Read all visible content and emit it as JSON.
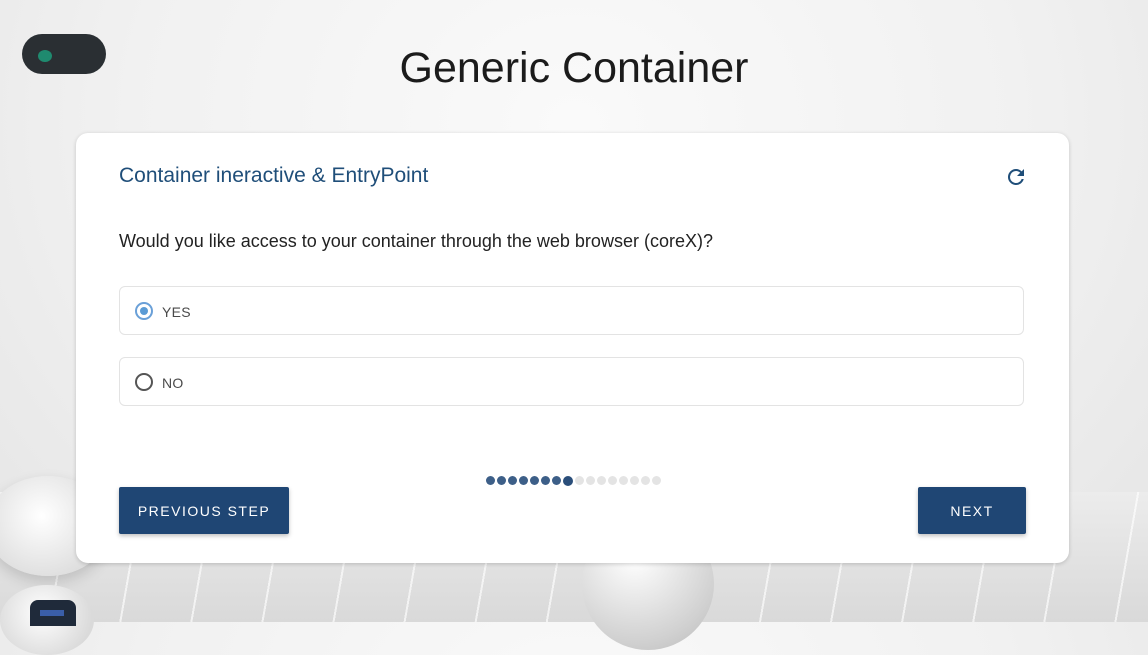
{
  "page": {
    "title": "Generic Container"
  },
  "card": {
    "title": "Container ineractive & EntryPoint",
    "refresh_icon": "refresh-icon",
    "question": "Would you like access to your container through the web browser (coreX)?",
    "options": [
      {
        "label": "YES",
        "selected": true
      },
      {
        "label": "NO",
        "selected": false
      }
    ]
  },
  "progress": {
    "completed_steps": 8,
    "total_steps": 16
  },
  "buttons": {
    "previous_label": "PREVIOUS STEP",
    "next_label": "NEXT"
  },
  "colors": {
    "accent": "#1f4674",
    "title": "#1f4e79",
    "radio_selected": "#5b9bd5"
  }
}
